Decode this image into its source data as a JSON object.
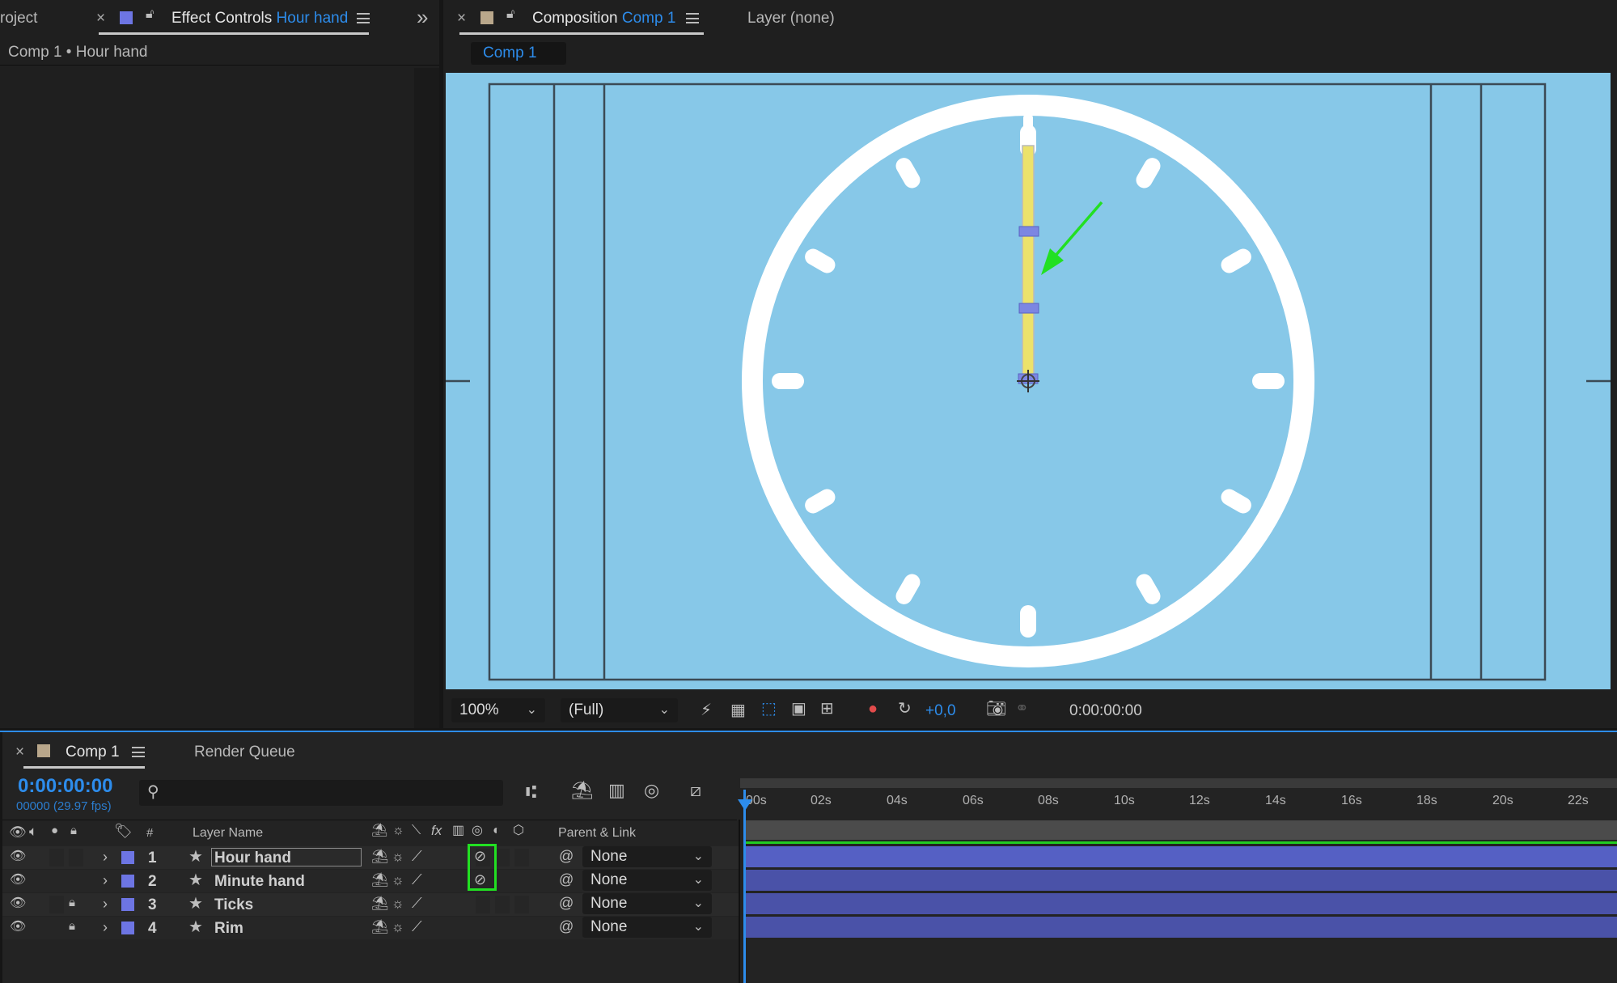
{
  "project_tab": {
    "label": "roject",
    "close": "×"
  },
  "effect_controls_tab": {
    "prefix": "Effect Controls",
    "layer": "Hour hand"
  },
  "expand_panels": "»",
  "effect_controls_breadcrumb": "Comp 1 • Hour hand",
  "composition_tab": {
    "close": "×",
    "prefix": "Composition",
    "comp": "Comp 1"
  },
  "layer_tab": "Layer (none)",
  "comp_subtab": "Comp 1",
  "viewer_toolbar": {
    "zoom": "100%",
    "resolution": "(Full)",
    "exposure": "+0,0",
    "timecode": "0:00:00:00"
  },
  "timeline_tab": {
    "close": "×",
    "label": "Comp 1"
  },
  "render_queue_tab": "Render Queue",
  "timeline": {
    "current_time": "0:00:00:00",
    "frame_info": "00000 (29.97 fps)",
    "search_placeholder": "",
    "columns": {
      "number": "#",
      "layer_name": "Layer Name",
      "parent": "Parent & Link"
    },
    "ruler": [
      "00s",
      "02s",
      "04s",
      "06s",
      "08s",
      "10s",
      "12s",
      "14s",
      "16s",
      "18s",
      "20s",
      "22s"
    ]
  },
  "layers": [
    {
      "num": "1",
      "name": "Hour hand",
      "parent": "None",
      "locked": false
    },
    {
      "num": "2",
      "name": "Minute hand",
      "parent": "None",
      "locked": false
    },
    {
      "num": "3",
      "name": "Ticks",
      "parent": "None",
      "locked": true
    },
    {
      "num": "4",
      "name": "Rim",
      "parent": "None",
      "locked": true
    }
  ],
  "colors": {
    "accent_blue": "#2d8ceb",
    "sky": "#87c8e8",
    "label_purple": "#6d75e3",
    "highlight_green": "#22e022",
    "hand_yellow": "#ece26a"
  }
}
